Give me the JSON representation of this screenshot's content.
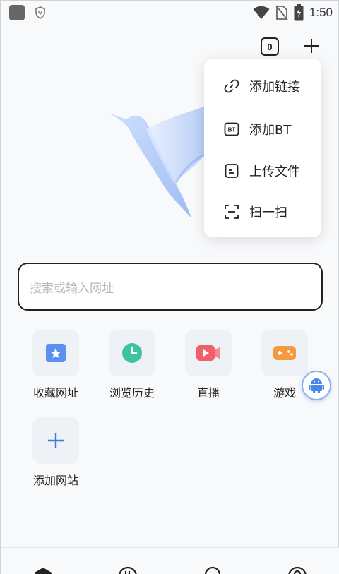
{
  "status_bar": {
    "time": "1:50",
    "icons": [
      "app-icon",
      "shield-icon",
      "wifi-icon",
      "no-sim-icon",
      "battery-charging-icon"
    ]
  },
  "top_bar": {
    "tab_count": "0",
    "add_icon": "plus-icon"
  },
  "menu": {
    "items": [
      {
        "label": "添加链接",
        "icon": "link-icon"
      },
      {
        "label": "添加BT",
        "icon": "bt-icon",
        "icon_text": "BT"
      },
      {
        "label": "上传文件",
        "icon": "file-icon"
      },
      {
        "label": "扫一扫",
        "icon": "scan-icon"
      }
    ]
  },
  "search": {
    "placeholder": "搜索或输入网址"
  },
  "shortcuts": [
    {
      "label": "收藏网址",
      "icon": "bookmark-icon",
      "color": "#5b8ff0"
    },
    {
      "label": "浏览历史",
      "icon": "history-icon",
      "color": "#3cc3a0"
    },
    {
      "label": "直播",
      "icon": "live-icon",
      "color": "#f0606a"
    },
    {
      "label": "游戏",
      "icon": "game-icon",
      "color": "#f59a3c"
    },
    {
      "label": "添加网站",
      "icon": "plus-icon",
      "color": "#3a7ce0"
    }
  ],
  "bottom_nav": {
    "icons": [
      "home-icon",
      "download-icon",
      "search-icon",
      "profile-icon"
    ]
  }
}
